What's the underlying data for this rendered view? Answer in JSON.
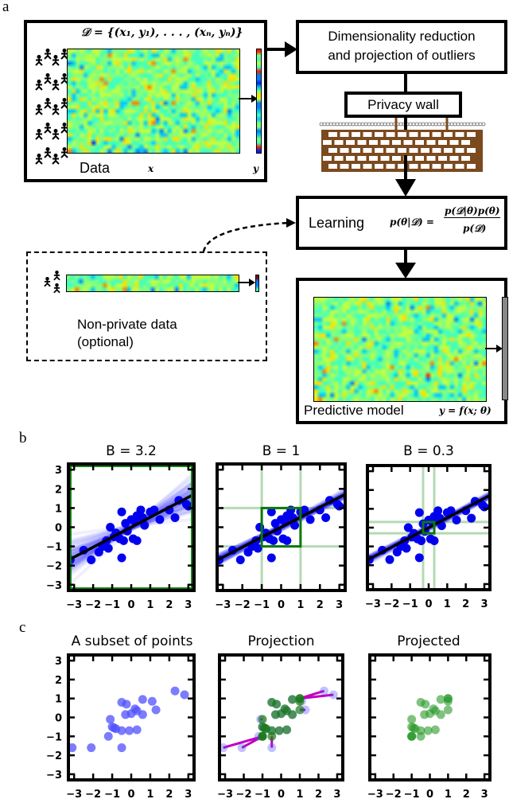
{
  "panel_labels": {
    "a": "a",
    "b": "b",
    "c": "c"
  },
  "panel_a": {
    "data_box": {
      "formula": "𝒟 = {(x₁, y₁), . . . , (xₙ, yₙ)}",
      "label": "Data",
      "x_label": "x",
      "y_label": "y"
    },
    "dim_reduction_box": {
      "line1": "Dimensionality reduction",
      "line2": "and projection of outliers"
    },
    "privacy_wall": {
      "label": "Privacy wall",
      "brick_color": "#7b4a1e"
    },
    "learning_box": {
      "label": "Learning",
      "formula_lhs": "p(θ|𝒟) =",
      "formula_num": "p(𝒟|θ)p(θ)",
      "formula_den": "p(𝒟)"
    },
    "non_private_box": {
      "line1": "Non-private data",
      "line2": "(optional)"
    },
    "predictive_box": {
      "label": "Predictive model",
      "formula": "y = f(x; θ)"
    },
    "colormap": [
      "#00008f",
      "#0020ff",
      "#0080ff",
      "#00c8ff",
      "#40ffbf",
      "#80ff80",
      "#c0ff40",
      "#ffe000",
      "#ff8000",
      "#ff2000",
      "#800000"
    ]
  },
  "chart_data": [
    {
      "type": "scatter",
      "panel": "b",
      "title": "B = 3.2",
      "bound": 3.2,
      "xlim": [
        -3.3,
        3.3
      ],
      "ylim": [
        -3.3,
        3.3
      ],
      "xticks": [
        -3,
        -2,
        -1,
        0,
        1,
        2,
        3
      ],
      "yticks": [
        -3,
        -2,
        -1,
        0,
        1,
        2,
        3
      ],
      "xtick_labels": [
        "−3",
        "−2",
        "−1",
        "0",
        "1",
        "2",
        "3"
      ],
      "ytick_labels": [
        "−3",
        "−2",
        "−1",
        "0",
        "1",
        "2",
        "3"
      ],
      "fit_line": {
        "slope": 0.52,
        "intercept": 0.0
      },
      "posterior_slope_spread": 0.55
    },
    {
      "type": "scatter",
      "panel": "b",
      "title": "B = 1",
      "bound": 1.0,
      "xlim": [
        -3.3,
        3.3
      ],
      "ylim": [
        -3.3,
        3.3
      ],
      "xticks": [
        -3,
        -2,
        -1,
        0,
        1,
        2,
        3
      ],
      "yticks": [
        -3,
        -2,
        -1,
        0,
        1,
        2,
        3
      ],
      "xtick_labels": [
        "−3",
        "−2",
        "−1",
        "0",
        "1",
        "2",
        "3"
      ],
      "ytick_labels": [],
      "fit_line": {
        "slope": 0.52,
        "intercept": 0.0
      },
      "posterior_slope_spread": 0.12
    },
    {
      "type": "scatter",
      "panel": "b",
      "title": "B = 0.3",
      "bound": 0.3,
      "xlim": [
        -3.3,
        3.3
      ],
      "ylim": [
        -3.3,
        3.3
      ],
      "xticks": [
        -3,
        -2,
        -1,
        0,
        1,
        2,
        3
      ],
      "yticks": [
        -3,
        -2,
        -1,
        0,
        1,
        2,
        3
      ],
      "xtick_labels": [
        "−3",
        "−2",
        "−1",
        "0",
        "1",
        "2",
        "3"
      ],
      "ytick_labels": [],
      "fit_line": {
        "slope": 0.52,
        "intercept": 0.0
      },
      "posterior_slope_spread": 0.1
    },
    {
      "type": "scatter",
      "panel": "c",
      "title": "A subset of points",
      "xlim": [
        -3.3,
        3.3
      ],
      "ylim": [
        -3.3,
        3.3
      ],
      "xticks": [
        -3,
        -2,
        -1,
        0,
        1,
        2,
        3
      ],
      "yticks": [
        -3,
        -2,
        -1,
        0,
        1,
        2,
        3
      ],
      "xtick_labels": [
        "−3",
        "−2",
        "−1",
        "0",
        "1",
        "2",
        "3"
      ],
      "ytick_labels": [
        "−3",
        "−2",
        "−1",
        "0",
        "1",
        "2",
        "3"
      ],
      "points": [
        [
          -3.1,
          -1.6
        ],
        [
          -2.1,
          -1.6
        ],
        [
          -0.5,
          -1.6
        ],
        [
          -1.2,
          -1.0
        ],
        [
          -1.1,
          -0.1
        ],
        [
          -0.9,
          -0.55
        ],
        [
          -1.0,
          -0.5
        ],
        [
          -0.8,
          -0.6
        ],
        [
          -0.5,
          -0.7
        ],
        [
          -0.1,
          -0.7
        ],
        [
          0.3,
          -0.65
        ],
        [
          -0.5,
          0.8
        ],
        [
          -0.25,
          0.7
        ],
        [
          -0.3,
          0.15
        ],
        [
          0.0,
          0.2
        ],
        [
          0.2,
          0.45
        ],
        [
          0.3,
          0.35
        ],
        [
          0.6,
          0.15
        ],
        [
          0.6,
          0.95
        ],
        [
          1.1,
          0.85
        ],
        [
          1.3,
          0.4
        ],
        [
          2.3,
          1.4
        ],
        [
          2.8,
          1.2
        ]
      ],
      "color": "#5050ff"
    },
    {
      "type": "scatter",
      "panel": "c",
      "title": "Projection",
      "bound": 1.0,
      "xlim": [
        -3.3,
        3.3
      ],
      "ylim": [
        -3.3,
        3.3
      ],
      "xticks": [
        -3,
        -2,
        -1,
        0,
        1,
        2,
        3
      ],
      "yticks": [
        -3,
        -2,
        -1,
        0,
        1,
        2,
        3
      ],
      "xtick_labels": [
        "−3",
        "−2",
        "−1",
        "0",
        "1",
        "2",
        "3"
      ],
      "ytick_labels": [],
      "source_color": "#5050ff",
      "projected_color": "#1a7a1a",
      "arrow_color": "#c000c0"
    },
    {
      "type": "scatter",
      "panel": "c",
      "title": "Projected",
      "bound": 1.0,
      "xlim": [
        -3.3,
        3.3
      ],
      "ylim": [
        -3.3,
        3.3
      ],
      "xticks": [
        -3,
        -2,
        -1,
        0,
        1,
        2,
        3
      ],
      "yticks": [
        -3,
        -2,
        -1,
        0,
        1,
        2,
        3
      ],
      "xtick_labels": [
        "−3",
        "−2",
        "−1",
        "0",
        "1",
        "2",
        "3"
      ],
      "ytick_labels": [],
      "color": "#2a9a2a"
    }
  ],
  "panel_b_points": [
    [
      -3.2,
      -1.7
    ],
    [
      -2.5,
      -1.2
    ],
    [
      -2.1,
      -1.7
    ],
    [
      -1.7,
      -1.3
    ],
    [
      -1.5,
      -1.0
    ],
    [
      -1.3,
      -0.7
    ],
    [
      -1.2,
      -1.1
    ],
    [
      -1.1,
      0.0
    ],
    [
      -0.9,
      -0.5
    ],
    [
      -0.8,
      -0.3
    ],
    [
      -0.6,
      -0.6
    ],
    [
      -0.5,
      0.8
    ],
    [
      -0.5,
      -1.6
    ],
    [
      -0.4,
      -0.7
    ],
    [
      -0.3,
      0.2
    ],
    [
      -0.2,
      -0.2
    ],
    [
      0.0,
      0.4
    ],
    [
      0.1,
      -0.6
    ],
    [
      0.2,
      0.3
    ],
    [
      0.3,
      -0.7
    ],
    [
      0.3,
      0.6
    ],
    [
      0.5,
      0.9
    ],
    [
      0.6,
      0.5
    ],
    [
      0.7,
      0.1
    ],
    [
      1.0,
      0.8
    ],
    [
      1.2,
      0.9
    ],
    [
      1.5,
      0.4
    ],
    [
      2.0,
      0.9
    ],
    [
      2.3,
      0.5
    ],
    [
      2.5,
      1.4
    ],
    [
      2.9,
      1.2
    ],
    [
      3.0,
      1.1
    ]
  ]
}
